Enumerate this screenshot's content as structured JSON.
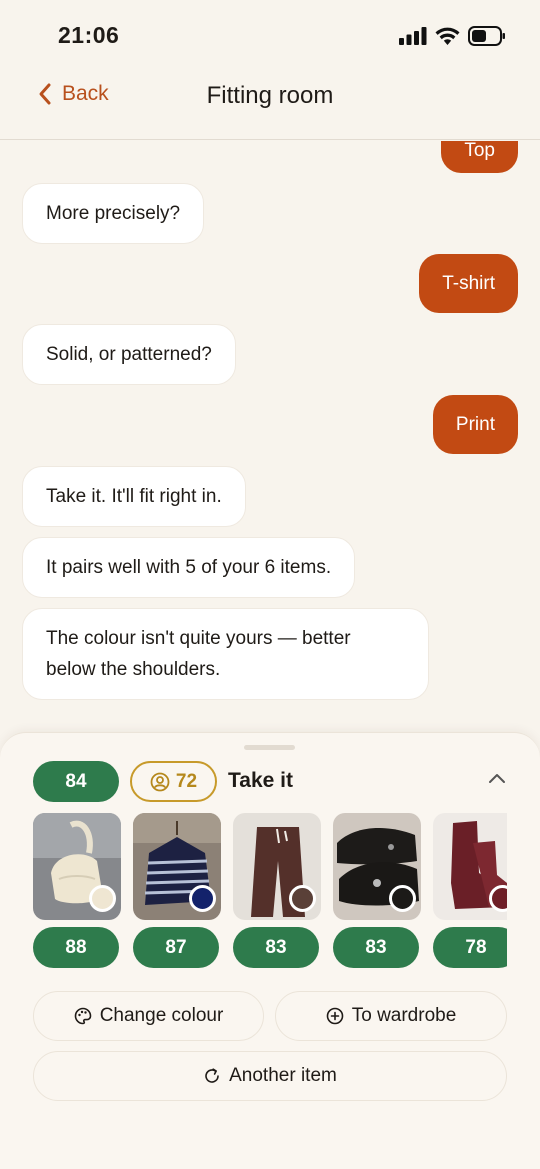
{
  "status": {
    "time": "21:06"
  },
  "nav": {
    "back_label": "Back",
    "title": "Fitting room"
  },
  "chat": [
    {
      "role": "user",
      "text": "Top"
    },
    {
      "role": "bot",
      "text": "More precisely?"
    },
    {
      "role": "user",
      "text": "T-shirt"
    },
    {
      "role": "bot",
      "text": "Solid, or patterned?"
    },
    {
      "role": "user",
      "text": "Print"
    },
    {
      "role": "bot",
      "text": "Take it. It'll fit right in."
    },
    {
      "role": "bot",
      "text": "It pairs well with 5 of your 6 items."
    },
    {
      "role": "bot",
      "text": "The colour isn't quite yours — better below the shoulders."
    }
  ],
  "panel": {
    "score": "84",
    "personal_score": "72",
    "verdict": "Take it",
    "items": [
      {
        "name": "cream-handbag",
        "score": "88",
        "swatch_color": "#efe6d2"
      },
      {
        "name": "striped-navy-sweater",
        "score": "87",
        "swatch_color": "#13226b"
      },
      {
        "name": "brown-trousers",
        "score": "83",
        "swatch_color": "#5a4038"
      },
      {
        "name": "black-sandals",
        "score": "83",
        "swatch_color": "#1c1a18"
      },
      {
        "name": "burgundy-boots",
        "score": "78",
        "swatch_color": "#6e1e26"
      }
    ],
    "change_colour_label": "Change colour",
    "to_wardrobe_label": "To wardrobe",
    "another_item_label": "Another item"
  },
  "colors": {
    "accent": "#c24a13",
    "score_green": "#2e7b4c",
    "personal_gold": "#c79a2a"
  }
}
